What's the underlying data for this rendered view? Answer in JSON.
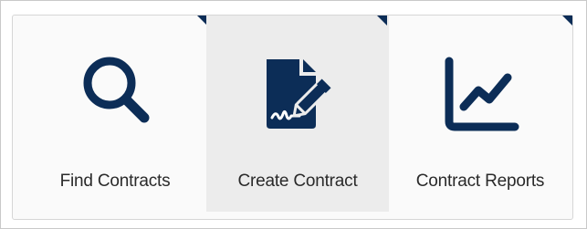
{
  "tiles": {
    "find": {
      "label": "Find Contracts",
      "icon": "magnifier-search-icon"
    },
    "create": {
      "label": "Create Contract",
      "icon": "signed-document-pen-icon",
      "state": "hovered"
    },
    "report": {
      "label": "Contract Reports",
      "icon": "line-chart-icon"
    }
  },
  "colors": {
    "icon": "#0c2d57",
    "hover_background": "#ececec",
    "label_text": "#2a2a2a"
  }
}
